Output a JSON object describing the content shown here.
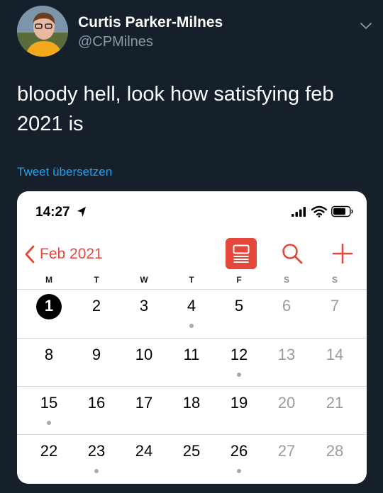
{
  "author": {
    "name": "Curtis Parker-Milnes",
    "handle": "@CPMilnes"
  },
  "tweet": {
    "text": "bloody hell, look how satisfying feb 2021 is",
    "translate_label": "Tweet übersetzen"
  },
  "phone": {
    "status_time": "14:27"
  },
  "calendar": {
    "back_label": "Feb 2021",
    "weekdays": [
      "M",
      "T",
      "W",
      "T",
      "F",
      "S",
      "S"
    ],
    "weeks": [
      [
        "1",
        "2",
        "3",
        "4",
        "5",
        "6",
        "7"
      ],
      [
        "8",
        "9",
        "10",
        "11",
        "12",
        "13",
        "14"
      ],
      [
        "15",
        "16",
        "17",
        "18",
        "19",
        "20",
        "21"
      ],
      [
        "22",
        "23",
        "24",
        "25",
        "26",
        "27",
        "28"
      ]
    ],
    "today": "1",
    "event_days": [
      "4",
      "12",
      "15",
      "23",
      "26"
    ]
  },
  "colors": {
    "background": "#15202b",
    "link": "#1da1f2",
    "calendar_accent": "#e5473a"
  }
}
